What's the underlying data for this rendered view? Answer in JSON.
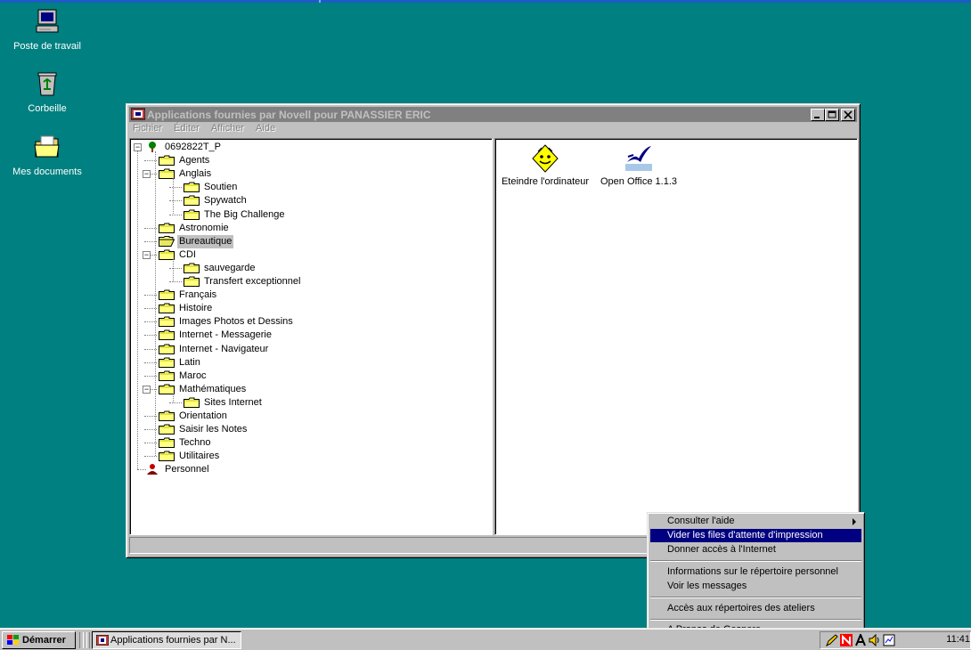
{
  "desktop": {
    "icons": [
      {
        "label": "Poste de travail",
        "icon": "my-computer-icon"
      },
      {
        "label": "Corbeille",
        "icon": "recycle-bin-icon"
      },
      {
        "label": "Mes documents",
        "icon": "my-documents-icon"
      }
    ]
  },
  "window": {
    "title": "Applications fournies par Novell pour PANASSIER ERIC",
    "controls": [
      "minimize",
      "maximize",
      "close"
    ],
    "menu": [
      "Fichier",
      "Éditer",
      "Afficher",
      "Aide"
    ],
    "tree": {
      "root": "0692822T_P",
      "items": [
        {
          "label": "Agents",
          "level": 1
        },
        {
          "label": "Anglais",
          "level": 1,
          "expanded": true
        },
        {
          "label": "Soutien",
          "level": 2
        },
        {
          "label": "Spywatch",
          "level": 2
        },
        {
          "label": "The Big Challenge",
          "level": 2
        },
        {
          "label": "Astronomie",
          "level": 1
        },
        {
          "label": "Bureautique",
          "level": 1,
          "selected": true
        },
        {
          "label": "CDI",
          "level": 1,
          "expanded": true
        },
        {
          "label": "sauvegarde",
          "level": 2
        },
        {
          "label": "Transfert exceptionnel",
          "level": 2
        },
        {
          "label": "Français",
          "level": 1
        },
        {
          "label": "Histoire",
          "level": 1
        },
        {
          "label": "Images Photos et Dessins",
          "level": 1
        },
        {
          "label": "Internet - Messagerie",
          "level": 1
        },
        {
          "label": "Internet - Navigateur",
          "level": 1
        },
        {
          "label": "Latin",
          "level": 1
        },
        {
          "label": "Maroc",
          "level": 1
        },
        {
          "label": "Mathématiques",
          "level": 1,
          "expanded": true
        },
        {
          "label": "Sites Internet",
          "level": 2
        },
        {
          "label": "Orientation",
          "level": 1
        },
        {
          "label": "Saisir les Notes",
          "level": 1
        },
        {
          "label": "Techno",
          "level": 1
        },
        {
          "label": "Utilitaires",
          "level": 1
        }
      ],
      "personal": "Personnel"
    },
    "apps": [
      {
        "label": "Eteindre l'ordinateur",
        "icon": "smiley-shutdown-icon"
      },
      {
        "label": "Open Office 1.1.3",
        "icon": "openoffice-gull-icon"
      }
    ],
    "status_text": ""
  },
  "context_menu": {
    "items": [
      {
        "label": "Consulter l'aide",
        "submenu": true
      },
      {
        "label": "Vider les files d'attente d'impression",
        "highlighted": true
      },
      {
        "label": "Donner accès à l'Internet"
      },
      {
        "label": "Informations sur le répertoire personnel"
      },
      {
        "label": "Voir les messages"
      },
      {
        "label": "Accès aux répertoires des ateliers"
      },
      {
        "label": "A Propos de Gespere"
      }
    ]
  },
  "taskbar": {
    "start_label": "Démarrer",
    "task_label": "Applications fournies par N...",
    "clock": "11:41"
  },
  "colors": {
    "desktop": "#008080",
    "highlight": "#000080",
    "folder": "#ffff80",
    "inactive_title": "#808080"
  }
}
